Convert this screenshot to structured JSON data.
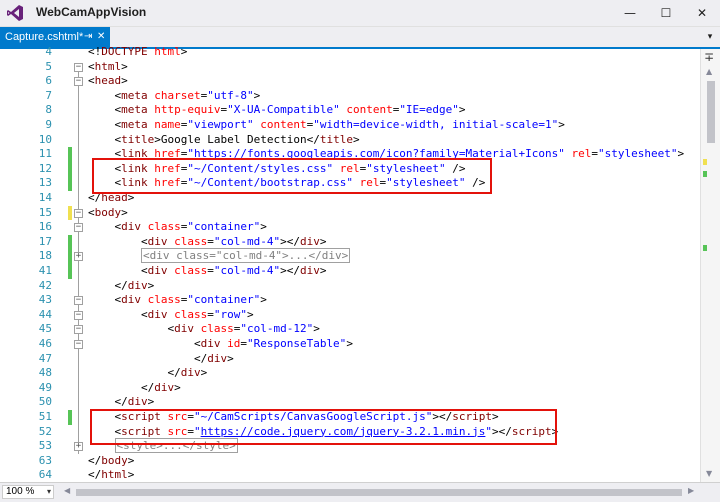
{
  "titlebar": {
    "app_title": "WebCamAppVision",
    "minimize": "—",
    "maximize": "☐",
    "close": "✕"
  },
  "tabs": [
    {
      "label": "Capture.cshtml*",
      "pin": "⇥",
      "close": "✕"
    }
  ],
  "tab_dropdown": "▾",
  "gutter_colors": {
    "saved": "#57c457",
    "unsaved": "#f0e050"
  },
  "accent": "#007acc",
  "highlight_color": "#e3120b",
  "lines": [
    {
      "n": "4",
      "change": "",
      "fold": "",
      "segs": [
        [
          "x",
          "<!"
        ],
        [
          "t",
          "DOCTYPE"
        ],
        [
          "x",
          " "
        ],
        [
          "a",
          "html"
        ],
        [
          "x",
          ">"
        ]
      ]
    },
    {
      "n": "5",
      "change": "",
      "fold": "-",
      "segs": [
        [
          "x",
          "<"
        ],
        [
          "t",
          "html"
        ],
        [
          "x",
          ">"
        ]
      ]
    },
    {
      "n": "6",
      "change": "",
      "fold": "-",
      "segs": [
        [
          "x",
          "<"
        ],
        [
          "t",
          "head"
        ],
        [
          "x",
          ">"
        ]
      ]
    },
    {
      "n": "7",
      "change": "",
      "fold": "",
      "segs": [
        [
          "x",
          "    <"
        ],
        [
          "t",
          "meta"
        ],
        [
          "x",
          " "
        ],
        [
          "a",
          "charset"
        ],
        [
          "x",
          "="
        ],
        [
          "s",
          "\"utf-8\""
        ],
        [
          "x",
          ">"
        ]
      ]
    },
    {
      "n": "8",
      "change": "",
      "fold": "",
      "segs": [
        [
          "x",
          "    <"
        ],
        [
          "t",
          "meta"
        ],
        [
          "x",
          " "
        ],
        [
          "a",
          "http-equiv"
        ],
        [
          "x",
          "="
        ],
        [
          "s",
          "\"X-UA-Compatible\""
        ],
        [
          "x",
          " "
        ],
        [
          "a",
          "content"
        ],
        [
          "x",
          "="
        ],
        [
          "s",
          "\"IE=edge\""
        ],
        [
          "x",
          ">"
        ]
      ]
    },
    {
      "n": "9",
      "change": "",
      "fold": "",
      "segs": [
        [
          "x",
          "    <"
        ],
        [
          "t",
          "meta"
        ],
        [
          "x",
          " "
        ],
        [
          "a",
          "name"
        ],
        [
          "x",
          "="
        ],
        [
          "s",
          "\"viewport\""
        ],
        [
          "x",
          " "
        ],
        [
          "a",
          "content"
        ],
        [
          "x",
          "="
        ],
        [
          "s",
          "\"width=device-width, initial-scale=1\""
        ],
        [
          "x",
          ">"
        ]
      ]
    },
    {
      "n": "10",
      "change": "",
      "fold": "",
      "segs": [
        [
          "x",
          "    <"
        ],
        [
          "t",
          "title"
        ],
        [
          "x",
          ">Google Label Detection</"
        ],
        [
          "t",
          "title"
        ],
        [
          "x",
          ">"
        ]
      ]
    },
    {
      "n": "11",
      "change": "saved",
      "fold": "",
      "segs": [
        [
          "x",
          "    <"
        ],
        [
          "t",
          "link"
        ],
        [
          "x",
          " "
        ],
        [
          "a",
          "href"
        ],
        [
          "x",
          "="
        ],
        [
          "s",
          "\"https://fonts.googleapis.com/icon?family=Material+Icons\""
        ],
        [
          "x",
          " "
        ],
        [
          "a",
          "rel"
        ],
        [
          "x",
          "="
        ],
        [
          "s",
          "\"stylesheet\""
        ],
        [
          "x",
          ">"
        ]
      ]
    },
    {
      "n": "12",
      "change": "saved",
      "fold": "",
      "segs": [
        [
          "x",
          "    <"
        ],
        [
          "t",
          "link"
        ],
        [
          "x",
          " "
        ],
        [
          "a",
          "href"
        ],
        [
          "x",
          "="
        ],
        [
          "s",
          "\"~/Content/styles.css\""
        ],
        [
          "x",
          " "
        ],
        [
          "a",
          "rel"
        ],
        [
          "x",
          "="
        ],
        [
          "s",
          "\"stylesheet\""
        ],
        [
          "x",
          " />"
        ]
      ]
    },
    {
      "n": "13",
      "change": "saved",
      "fold": "",
      "segs": [
        [
          "x",
          "    <"
        ],
        [
          "t",
          "link"
        ],
        [
          "x",
          " "
        ],
        [
          "a",
          "href"
        ],
        [
          "x",
          "="
        ],
        [
          "s",
          "\"~/Content/bootstrap.css\""
        ],
        [
          "x",
          " "
        ],
        [
          "a",
          "rel"
        ],
        [
          "x",
          "="
        ],
        [
          "s",
          "\"stylesheet\""
        ],
        [
          "x",
          " />"
        ]
      ]
    },
    {
      "n": "14",
      "change": "",
      "fold": "",
      "segs": [
        [
          "x",
          "</"
        ],
        [
          "t",
          "head"
        ],
        [
          "x",
          ">"
        ]
      ]
    },
    {
      "n": "15",
      "change": "unsaved",
      "fold": "-",
      "segs": [
        [
          "x",
          "<"
        ],
        [
          "t",
          "body"
        ],
        [
          "x",
          ">"
        ]
      ]
    },
    {
      "n": "16",
      "change": "",
      "fold": "-",
      "segs": [
        [
          "x",
          "    <"
        ],
        [
          "t",
          "div"
        ],
        [
          "x",
          " "
        ],
        [
          "a",
          "class"
        ],
        [
          "x",
          "="
        ],
        [
          "s",
          "\"container\""
        ],
        [
          "x",
          ">"
        ]
      ]
    },
    {
      "n": "17",
      "change": "saved",
      "fold": "",
      "segs": [
        [
          "x",
          "        <"
        ],
        [
          "t",
          "div"
        ],
        [
          "x",
          " "
        ],
        [
          "a",
          "class"
        ],
        [
          "x",
          "="
        ],
        [
          "s",
          "\"col-md-4\""
        ],
        [
          "x",
          "></"
        ],
        [
          "t",
          "div"
        ],
        [
          "x",
          ">"
        ]
      ]
    },
    {
      "n": "18",
      "change": "saved",
      "fold": "+",
      "segs": [
        [
          "x",
          "        "
        ],
        [
          "c",
          "<div class=\"col-md-4\">...</div>"
        ]
      ]
    },
    {
      "n": "41",
      "change": "saved",
      "fold": "",
      "segs": [
        [
          "x",
          "        <"
        ],
        [
          "t",
          "div"
        ],
        [
          "x",
          " "
        ],
        [
          "a",
          "class"
        ],
        [
          "x",
          "="
        ],
        [
          "s",
          "\"col-md-4\""
        ],
        [
          "x",
          "></"
        ],
        [
          "t",
          "div"
        ],
        [
          "x",
          ">"
        ]
      ]
    },
    {
      "n": "42",
      "change": "",
      "fold": "",
      "segs": [
        [
          "x",
          "    </"
        ],
        [
          "t",
          "div"
        ],
        [
          "x",
          ">"
        ]
      ]
    },
    {
      "n": "43",
      "change": "",
      "fold": "-",
      "segs": [
        [
          "x",
          "    <"
        ],
        [
          "t",
          "div"
        ],
        [
          "x",
          " "
        ],
        [
          "a",
          "class"
        ],
        [
          "x",
          "="
        ],
        [
          "s",
          "\"container\""
        ],
        [
          "x",
          ">"
        ]
      ]
    },
    {
      "n": "44",
      "change": "",
      "fold": "-",
      "segs": [
        [
          "x",
          "        <"
        ],
        [
          "t",
          "div"
        ],
        [
          "x",
          " "
        ],
        [
          "a",
          "class"
        ],
        [
          "x",
          "="
        ],
        [
          "s",
          "\"row\""
        ],
        [
          "x",
          ">"
        ]
      ]
    },
    {
      "n": "45",
      "change": "",
      "fold": "-",
      "segs": [
        [
          "x",
          "            <"
        ],
        [
          "t",
          "div"
        ],
        [
          "x",
          " "
        ],
        [
          "a",
          "class"
        ],
        [
          "x",
          "="
        ],
        [
          "s",
          "\"col-md-12\""
        ],
        [
          "x",
          ">"
        ]
      ]
    },
    {
      "n": "46",
      "change": "",
      "fold": "-",
      "segs": [
        [
          "x",
          "                <"
        ],
        [
          "t",
          "div"
        ],
        [
          "x",
          " "
        ],
        [
          "a",
          "id"
        ],
        [
          "x",
          "="
        ],
        [
          "s",
          "\"ResponseTable\""
        ],
        [
          "x",
          ">"
        ]
      ]
    },
    {
      "n": "47",
      "change": "",
      "fold": "",
      "segs": [
        [
          "x",
          "                </"
        ],
        [
          "t",
          "div"
        ],
        [
          "x",
          ">"
        ]
      ]
    },
    {
      "n": "48",
      "change": "",
      "fold": "",
      "segs": [
        [
          "x",
          "            </"
        ],
        [
          "t",
          "div"
        ],
        [
          "x",
          ">"
        ]
      ]
    },
    {
      "n": "49",
      "change": "",
      "fold": "",
      "segs": [
        [
          "x",
          "        </"
        ],
        [
          "t",
          "div"
        ],
        [
          "x",
          ">"
        ]
      ]
    },
    {
      "n": "50",
      "change": "",
      "fold": "",
      "segs": [
        [
          "x",
          "    </"
        ],
        [
          "t",
          "div"
        ],
        [
          "x",
          ">"
        ]
      ]
    },
    {
      "n": "51",
      "change": "saved",
      "fold": "",
      "segs": [
        [
          "x",
          "    <"
        ],
        [
          "t",
          "script"
        ],
        [
          "x",
          " "
        ],
        [
          "a",
          "src"
        ],
        [
          "x",
          "="
        ],
        [
          "s",
          "\"~/CamScripts/CanvasGoogleScript.js\""
        ],
        [
          "x",
          "></"
        ],
        [
          "t",
          "script"
        ],
        [
          "x",
          ">"
        ]
      ]
    },
    {
      "n": "52",
      "change": "",
      "fold": "",
      "segs": [
        [
          "x",
          "    <"
        ],
        [
          "t",
          "script"
        ],
        [
          "x",
          " "
        ],
        [
          "a",
          "src"
        ],
        [
          "x",
          "="
        ],
        [
          "s",
          "\""
        ],
        [
          "u",
          "https://code.jquery.com/jquery-3.2.1.min.js"
        ],
        [
          "s",
          "\""
        ],
        [
          "x",
          "></"
        ],
        [
          "t",
          "script"
        ],
        [
          "x",
          ">"
        ]
      ]
    },
    {
      "n": "53",
      "change": "",
      "fold": "+",
      "segs": [
        [
          "x",
          "    "
        ],
        [
          "c",
          "<style>...</style>"
        ]
      ]
    },
    {
      "n": "63",
      "change": "",
      "fold": "",
      "segs": [
        [
          "x",
          "</"
        ],
        [
          "t",
          "body"
        ],
        [
          "x",
          ">"
        ]
      ]
    },
    {
      "n": "64",
      "change": "",
      "fold": "",
      "segs": [
        [
          "x",
          "</"
        ],
        [
          "t",
          "html"
        ],
        [
          "x",
          ">"
        ]
      ]
    }
  ],
  "statusbar": {
    "zoom": "100 %",
    "zoom_arrow": "▾",
    "scroll_left": "◀",
    "scroll_right": "▶"
  },
  "scrollbar": {
    "split": "∓",
    "up": "▲",
    "down": "▼"
  }
}
